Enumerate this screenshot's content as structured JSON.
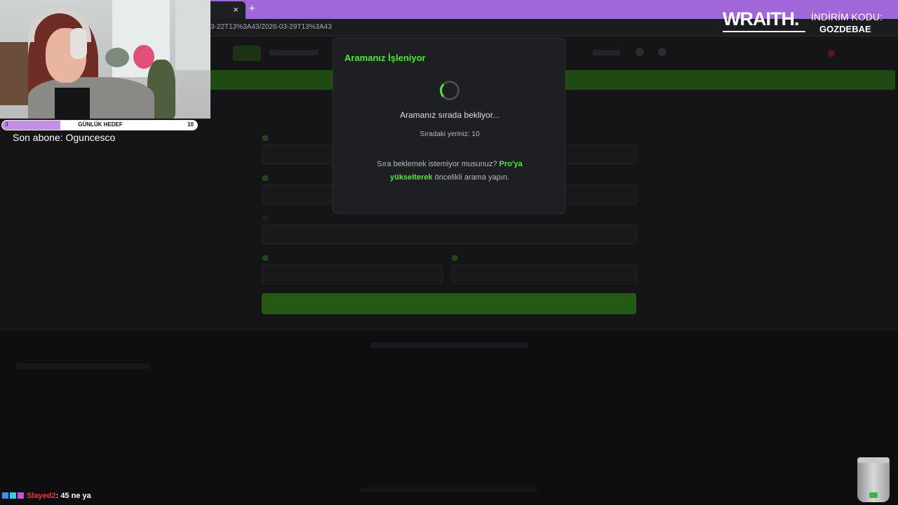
{
  "browser": {
    "url": "3-22T13%3A43/2026-03-29T13%3A43",
    "tab_close": "×",
    "new_tab": "+"
  },
  "page": {
    "nav": {
      "active_item": "",
      "items": [
        "",
        ""
      ],
      "language": ""
    },
    "form": {
      "labels": [
        "",
        "",
        "",
        "",
        ""
      ],
      "placeholders": [
        "",
        "",
        "",
        "",
        ""
      ],
      "search_button": ""
    },
    "footer_note_prefix": "",
    "footer_note_link": "",
    "cookie_note": "",
    "copyright": ""
  },
  "modal": {
    "title": "Aramanız İşleniyor",
    "status": "Aramanız sırada bekliyor...",
    "queue_text": "Sıradaki yeriniz: 10",
    "promo_prefix": "Sıra beklemek istemiyor musunuz? ",
    "promo_link": "Pro'ya yükselterek",
    "promo_suffix": " öncelikli arama yapın."
  },
  "overlay": {
    "goal": {
      "min": "3",
      "label": "GÜNLÜK HEDEF",
      "max": "10",
      "progress": 0.3
    },
    "last_sub": "Son abone: Oguncesco",
    "sponsor_brand": "WRAITH.",
    "sponsor_label": "İNDİRİM KODU:",
    "sponsor_code": "GOZDEBAE",
    "chat": {
      "user": "Slayed2",
      "message": ": 45 ne ya"
    }
  },
  "colors": {
    "accent": "#53e63b",
    "tabstrip": "#a066d8",
    "modal_bg": "#1e1f22",
    "goal_fill": "#c38ee8"
  }
}
